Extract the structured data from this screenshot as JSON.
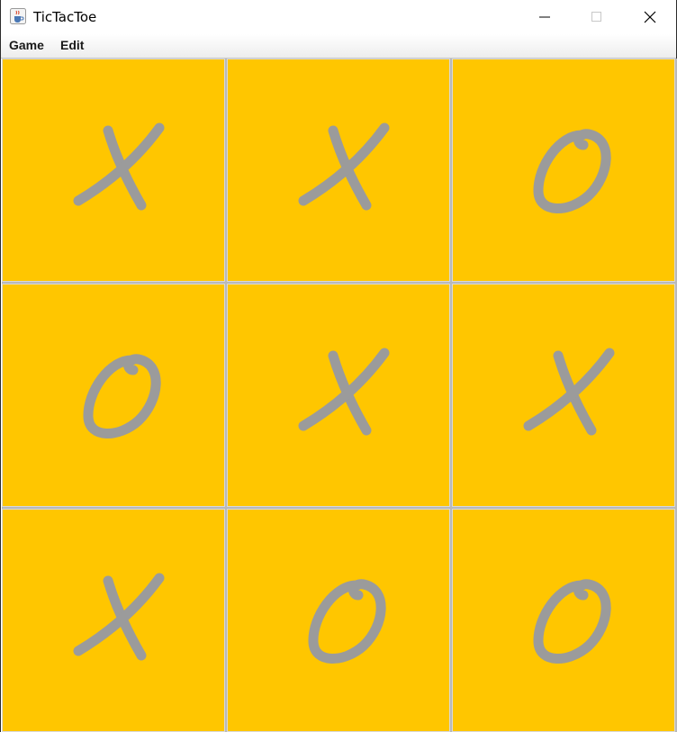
{
  "window": {
    "title": "TicTacToe"
  },
  "titlebar": {
    "app_icon": "java-coffee-cup-icon",
    "minimize_icon": "minimize-icon",
    "maximize_icon": "maximize-icon",
    "close_icon": "close-icon"
  },
  "menubar": {
    "items": [
      "Game",
      "Edit"
    ]
  },
  "board": {
    "cells": [
      "X",
      "X",
      "O",
      "O",
      "X",
      "X",
      "X",
      "O",
      "O"
    ],
    "cell_color": "#ffc600",
    "mark_color": "#9b9b9b",
    "grid_color": "#b9b9b9"
  }
}
